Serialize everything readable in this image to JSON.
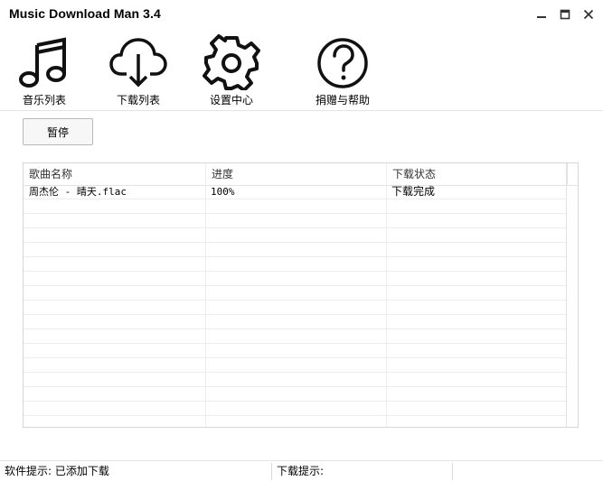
{
  "window": {
    "title": "Music Download Man 3.4",
    "minimize_icon": "minimize-icon",
    "maximize_icon": "maximize-icon",
    "close_icon": "close-icon"
  },
  "toolbar": {
    "items": [
      {
        "label": "音乐列表",
        "icon": "music-note-icon"
      },
      {
        "label": "下载列表",
        "icon": "cloud-download-icon"
      },
      {
        "label": "设置中心",
        "icon": "gear-icon"
      },
      {
        "label": "捐赠与帮助",
        "icon": "help-icon"
      }
    ]
  },
  "actions": {
    "pause_label": "暂停"
  },
  "table": {
    "columns": [
      "歌曲名称",
      "进度",
      "下载状态"
    ],
    "rows": [
      {
        "name": "周杰伦 - 晴天.flac",
        "progress": "100%",
        "status": "下载完成"
      }
    ]
  },
  "statusbar": {
    "software_hint": "软件提示: 已添加下载",
    "download_hint": "下载提示:"
  },
  "colors": {
    "border": "#d6d6d6",
    "background": "#ffffff"
  }
}
